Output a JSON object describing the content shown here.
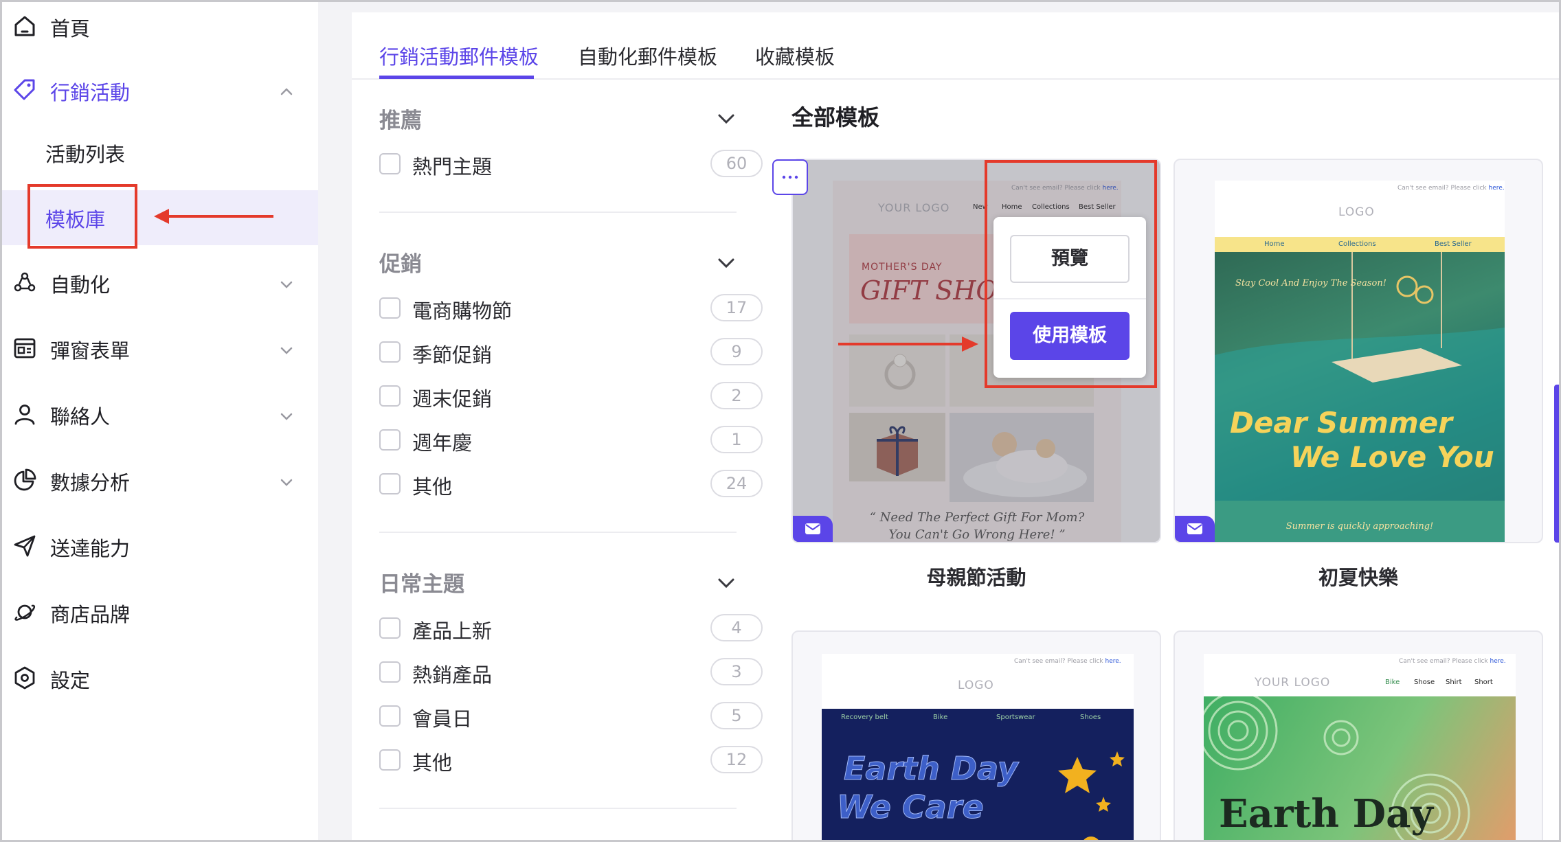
{
  "sidebar": {
    "items": [
      {
        "label": "首頁",
        "icon": "home-icon"
      },
      {
        "label": "行銷活動",
        "icon": "tag-icon"
      },
      {
        "label": "自動化",
        "icon": "automation-icon"
      },
      {
        "label": "彈窗表單",
        "icon": "popup-form-icon"
      },
      {
        "label": "聯絡人",
        "icon": "user-icon"
      },
      {
        "label": "數據分析",
        "icon": "pie-chart-icon"
      },
      {
        "label": "送達能力",
        "icon": "send-icon"
      },
      {
        "label": "商店品牌",
        "icon": "planet-icon"
      },
      {
        "label": "設定",
        "icon": "settings-hexagon-icon"
      }
    ],
    "subitems": [
      {
        "label": "活動列表"
      },
      {
        "label": "模板庫"
      }
    ]
  },
  "tabs": [
    {
      "label": "行銷活動郵件模板"
    },
    {
      "label": "自動化郵件模板"
    },
    {
      "label": "收藏模板"
    }
  ],
  "filters": [
    {
      "title": "推薦",
      "options": [
        {
          "label": "熱門主題",
          "count": "60"
        }
      ]
    },
    {
      "title": "促銷",
      "options": [
        {
          "label": "電商購物節",
          "count": "17"
        },
        {
          "label": "季節促銷",
          "count": "9"
        },
        {
          "label": "週末促銷",
          "count": "2"
        },
        {
          "label": "週年慶",
          "count": "1"
        },
        {
          "label": "其他",
          "count": "24"
        }
      ]
    },
    {
      "title": "日常主題",
      "options": [
        {
          "label": "產品上新",
          "count": "4"
        },
        {
          "label": "熱銷產品",
          "count": "3"
        },
        {
          "label": "會員日",
          "count": "5"
        },
        {
          "label": "其他",
          "count": "12"
        }
      ]
    }
  ],
  "templates": {
    "title": "全部模板",
    "cards": [
      {
        "name": "母親節活動"
      },
      {
        "name": "初夏快樂"
      }
    ],
    "menu": {
      "preview": "預覽",
      "use": "使用模板"
    }
  },
  "emails": {
    "cant_see": "Can't see email? Please click",
    "here": "here.",
    "mother": {
      "logo": "YOUR LOGO",
      "nav": [
        "New",
        "Home",
        "Collections",
        "Best Seller"
      ],
      "kicker": "MOTHER'S DAY",
      "headline": "GIFT SHO",
      "quote1": "“ Need The Perfect Gift For Mom?",
      "quote2": "You Can't Go Wrong Here! ”"
    },
    "summer": {
      "logo": "LOGO",
      "nav": [
        "Home",
        "Collections",
        "Best Seller"
      ],
      "tagline": "Stay Cool And Enjoy The Season!",
      "line1": "Dear Summer",
      "line2": "We Love You",
      "footer": "Summer is quickly approaching!"
    },
    "earth1": {
      "logo": "LOGO",
      "nav": [
        "Recovery belt",
        "Bike",
        "Sportswear",
        "Shoes"
      ],
      "line1": "Earth Day",
      "line2": "We Care"
    },
    "earth2": {
      "logo": "YOUR LOGO",
      "nav": [
        "Bike",
        "Shose",
        "Shirt",
        "Short"
      ],
      "headline": "Earth Day"
    }
  },
  "colors": {
    "accent": "#5b45e8",
    "annotation": "#e43a2b"
  }
}
